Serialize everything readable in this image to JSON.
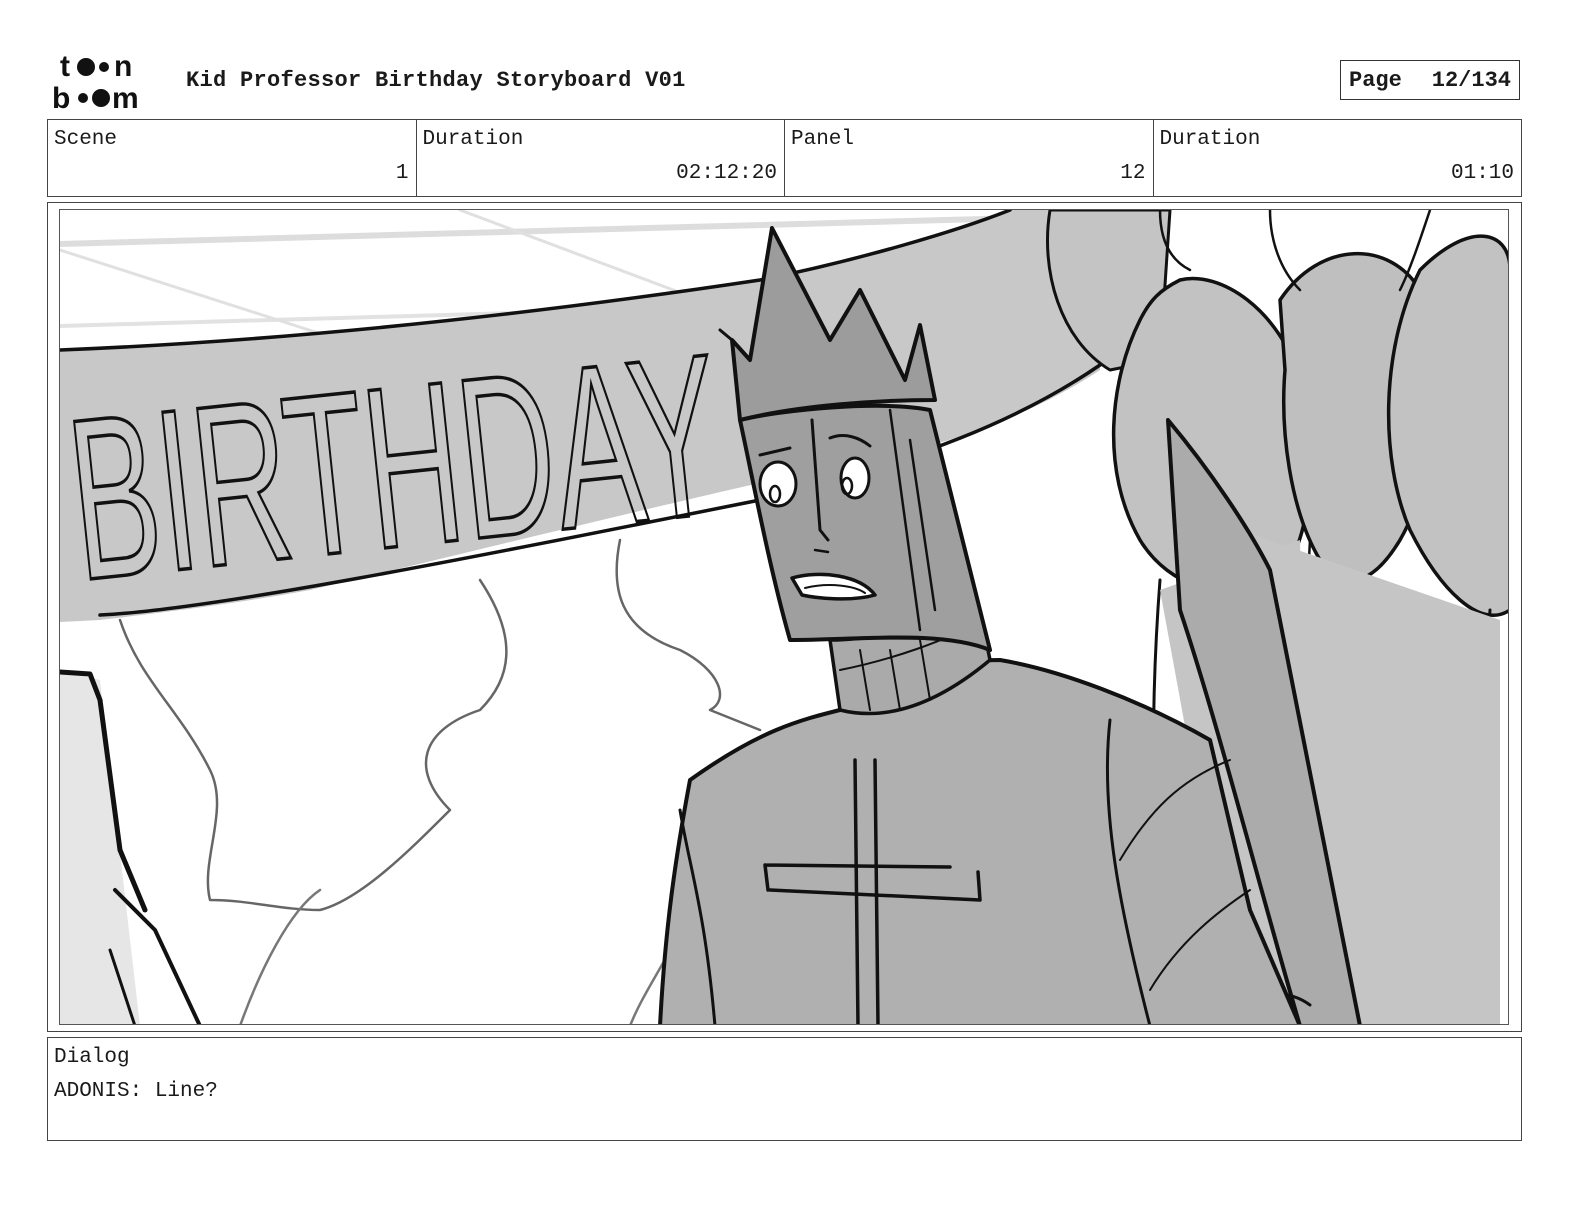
{
  "header": {
    "logo_text": "toon boom",
    "title": "Kid Professor Birthday Storyboard V01",
    "page_label": "Page",
    "page_value": "12/134"
  },
  "info": {
    "scene_label": "Scene",
    "scene_value": "1",
    "scene_duration_label": "Duration",
    "scene_duration_value": "02:12:20",
    "panel_label": "Panel",
    "panel_value": "12",
    "panel_duration_label": "Duration",
    "panel_duration_value": "01:10"
  },
  "panel": {
    "banner_text": "BIRTHDAY"
  },
  "dialog": {
    "label": "Dialog",
    "text": "ADONIS: Line?"
  }
}
